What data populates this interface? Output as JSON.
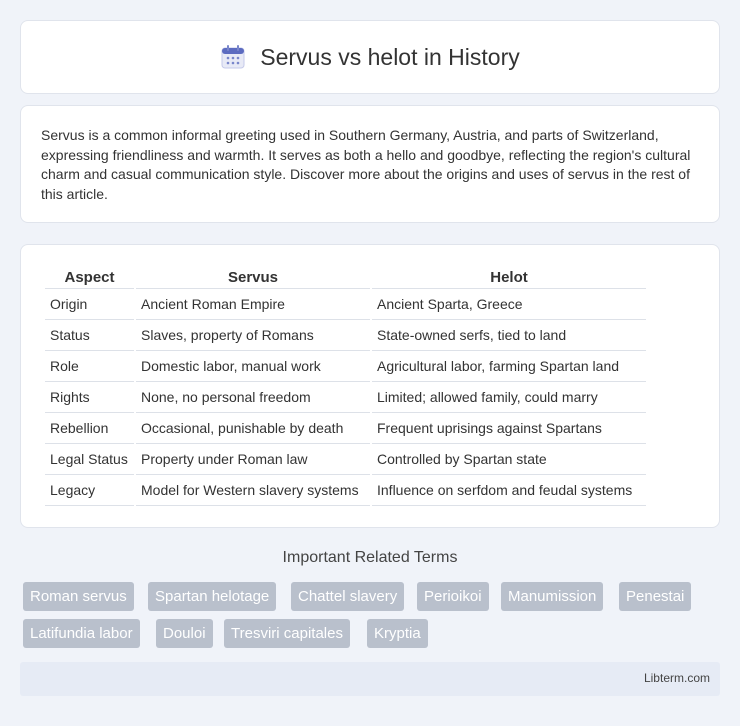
{
  "header": {
    "title": "Servus vs helot in History",
    "icon": "calendar-icon"
  },
  "intro": "Servus is a common informal greeting used in Southern Germany, Austria, and parts of Switzerland, expressing friendliness and warmth. It serves as both a hello and goodbye, reflecting the region's cultural charm and casual communication style. Discover more about the origins and uses of servus in the rest of this article.",
  "table": {
    "headers": [
      "Aspect",
      "Servus",
      "Helot"
    ],
    "rows": [
      [
        "Origin",
        "Ancient Roman Empire",
        "Ancient Sparta, Greece"
      ],
      [
        "Status",
        "Slaves, property of Romans",
        "State-owned serfs, tied to land"
      ],
      [
        "Role",
        "Domestic labor, manual work",
        "Agricultural labor, farming Spartan land"
      ],
      [
        "Rights",
        "None, no personal freedom",
        "Limited; allowed family, could marry"
      ],
      [
        "Rebellion",
        "Occasional, punishable by death",
        "Frequent uprisings against Spartans"
      ],
      [
        "Legal Status",
        "Property under Roman law",
        "Controlled by Spartan state"
      ],
      [
        "Legacy",
        "Model for Western slavery systems",
        "Influence on serfdom and feudal systems"
      ]
    ]
  },
  "related": {
    "title": "Important Related Terms",
    "tags": [
      "Roman servus",
      "Spartan helotage",
      "Chattel slavery",
      "Perioikoi",
      "Manumission",
      "Penestai",
      "Latifundia labor",
      "Douloi",
      "Tresviri capitales",
      "Kryptia"
    ]
  },
  "footer": {
    "site": "Libterm.com"
  },
  "colors": {
    "background": "#f0f3f9",
    "tag": "#b9c0cc",
    "footer": "#e6ebf5"
  }
}
